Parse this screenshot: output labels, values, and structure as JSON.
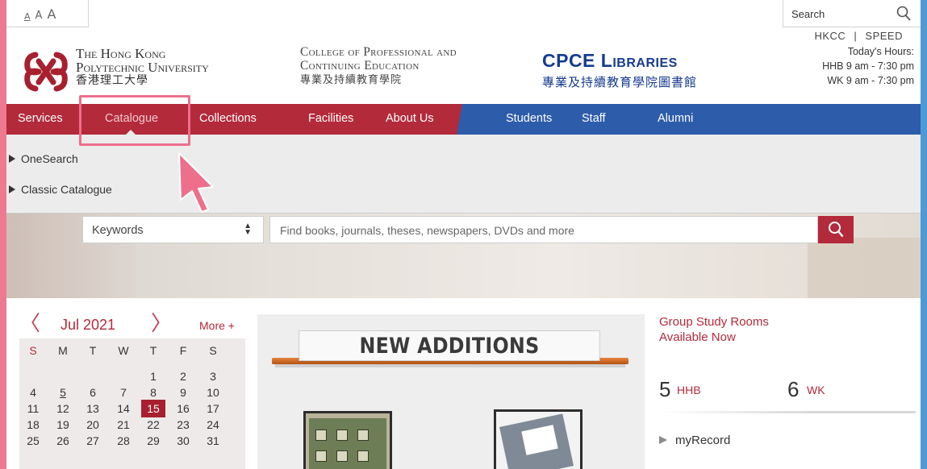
{
  "font_controls": [
    "A",
    "A",
    "A"
  ],
  "search": {
    "label": "Search",
    "icon": "search-icon"
  },
  "links": {
    "hkcc": "HKCC",
    "separator": "|",
    "speed": "SPEED"
  },
  "hours": {
    "title": "Today's Hours:",
    "hhb": "HHB 9 am - 7:30 pm",
    "wk": "WK 9 am - 7:30 pm"
  },
  "logos": {
    "polyu_line1": "The Hong Kong",
    "polyu_line2": "Polytechnic University",
    "polyu_line3": "香港理工大學",
    "cpce_line1": "College of Professional and",
    "cpce_line2": "Continuing Education",
    "cpce_line3": "專業及持續教育學院",
    "lib_line1": "CPCE Libraries",
    "lib_line2": "專業及持續教育學院圖書館"
  },
  "nav": {
    "items": [
      "Services",
      "Catalogue",
      "Collections",
      "Facilities",
      "About Us",
      "Students",
      "Staff",
      "Alumni"
    ],
    "active": "Catalogue"
  },
  "dropdown": {
    "items": [
      "OneSearch",
      "Classic Catalogue"
    ]
  },
  "hero": {
    "select_value": "Keywords",
    "placeholder": "Find books, journals, theses, newspapers, DVDs and more"
  },
  "calendar": {
    "prev": "〈",
    "next": "〉",
    "title": "Jul 2021",
    "more": "More +",
    "weekdays": [
      "S",
      "M",
      "T",
      "W",
      "T",
      "F",
      "S"
    ],
    "weeks": [
      [
        "",
        "",
        "",
        "",
        "1",
        "2",
        "3"
      ],
      [
        "4",
        "5",
        "6",
        "7",
        "8",
        "9",
        "10"
      ],
      [
        "11",
        "12",
        "13",
        "14",
        "15",
        "16",
        "17"
      ],
      [
        "18",
        "19",
        "20",
        "21",
        "22",
        "23",
        "24"
      ],
      [
        "25",
        "26",
        "27",
        "28",
        "29",
        "30",
        "31"
      ]
    ],
    "today": "15",
    "underlined": "5",
    "colors": {
      "accent": "#b32a3a",
      "today_bg": "#a8202f"
    }
  },
  "new_additions": {
    "title": "NEW ADDITIONS"
  },
  "study_rooms": {
    "title_line1": "Group Study Rooms",
    "title_line2": "Available Now",
    "hhb_count": "5",
    "hhb_label": "HHB",
    "wk_count": "6",
    "wk_label": "WK"
  },
  "myrecord": {
    "label": "myRecord"
  },
  "colors": {
    "nav_red": "#b32a3a",
    "nav_blue": "#2d5cab",
    "highlight": "#ee6f8b",
    "lib_blue": "#163b8f"
  }
}
